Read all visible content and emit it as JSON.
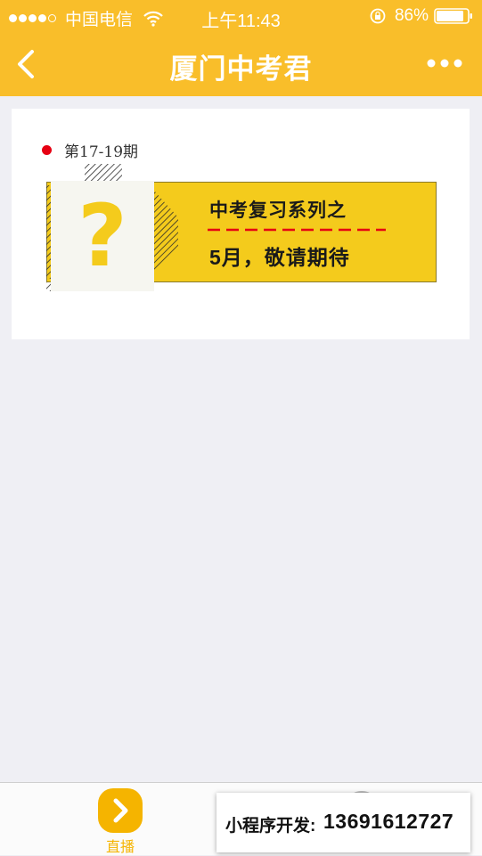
{
  "status_bar": {
    "carrier": "中国电信",
    "time": "上午11:43",
    "battery": "86%",
    "signal_bars_filled": 4,
    "battery_level": 0.86
  },
  "nav": {
    "title": "厦门中考君"
  },
  "card": {
    "issue": "第17-19期",
    "banner": {
      "line1": "中考复习系列之",
      "line2": "5月，敬请期待",
      "question_mark": "?"
    }
  },
  "tabbar": {
    "live_label": "直播"
  },
  "dev_banner": {
    "label": "小程序开发:",
    "phone": "13691612727"
  },
  "colors": {
    "header": "#f9be2a",
    "banner_yellow": "#f4cb1c",
    "accent_red": "#e60012",
    "tab_active": "#f5b400",
    "page_bg": "#efeff4"
  }
}
